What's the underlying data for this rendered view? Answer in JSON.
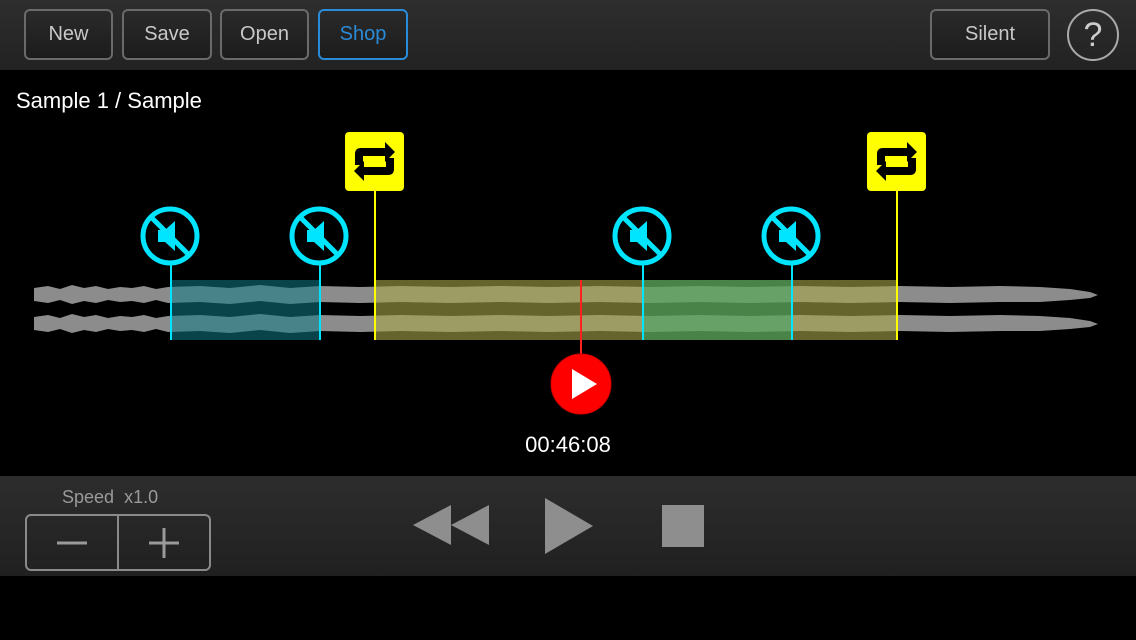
{
  "toolbar": {
    "new_label": "New",
    "save_label": "Save",
    "open_label": "Open",
    "shop_label": "Shop",
    "silent_label": "Silent",
    "help_label": "?"
  },
  "track": {
    "title": "Sample 1 / Sample",
    "time": "00:46:08"
  },
  "speed": {
    "label": "Speed",
    "value": "x1.0",
    "minus_icon": "minus-icon",
    "plus_icon": "plus-icon"
  },
  "transport": {
    "rewind_icon": "rewind-icon",
    "play_icon": "play-icon",
    "stop_icon": "stop-icon"
  },
  "colors": {
    "accent": "#2a8bd8",
    "mute_marker": "#00e5ff",
    "loop_marker": "#ffff00",
    "playhead": "#ff0000",
    "mute_region": "#0e7c86",
    "loop_region": "#a7a74a"
  }
}
